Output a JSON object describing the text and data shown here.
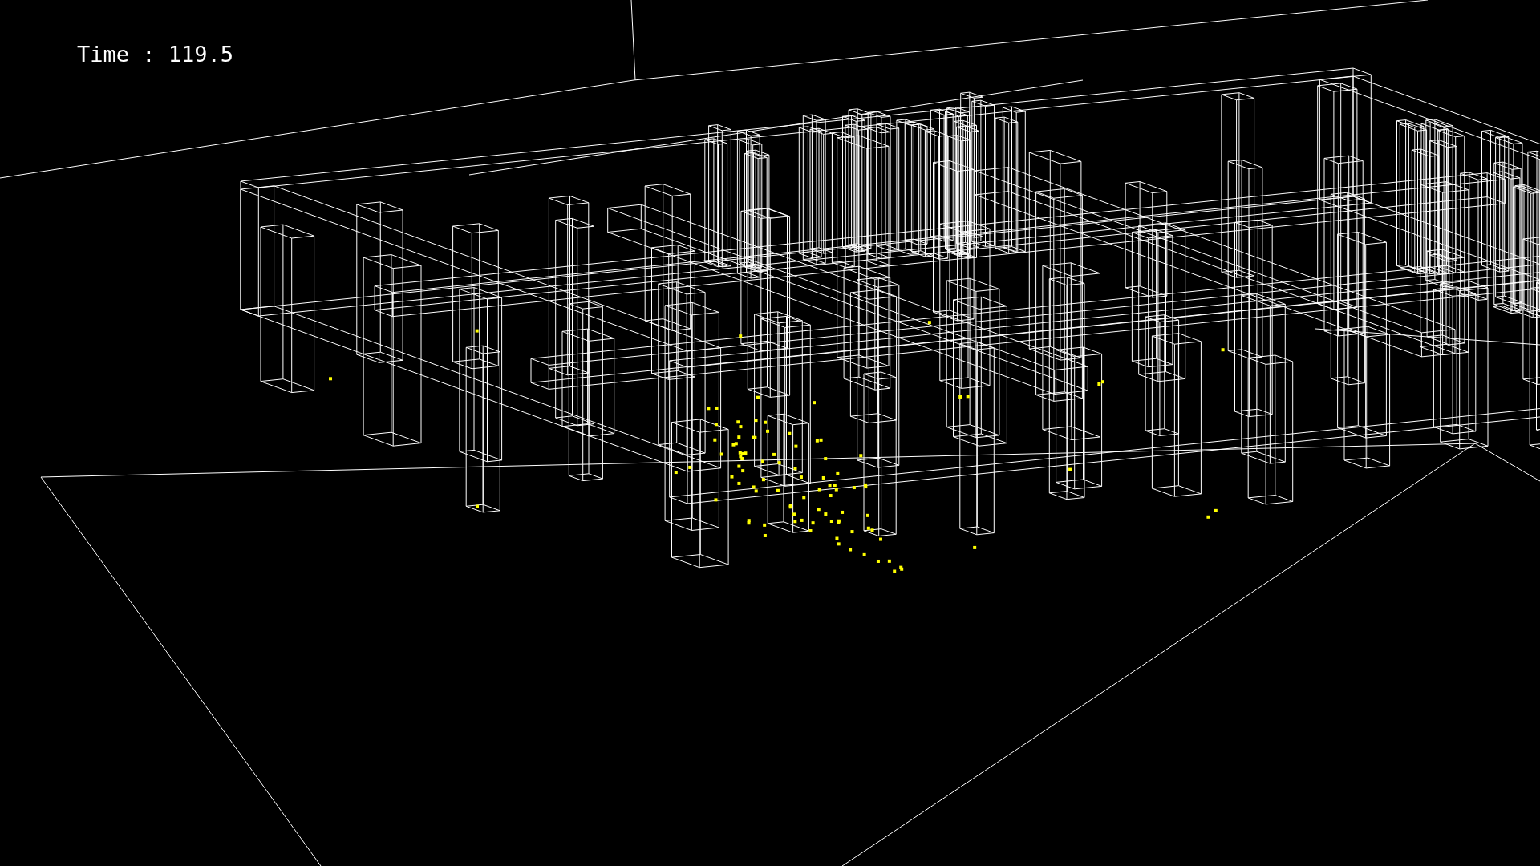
{
  "time_label": "Time : 119.5"
}
